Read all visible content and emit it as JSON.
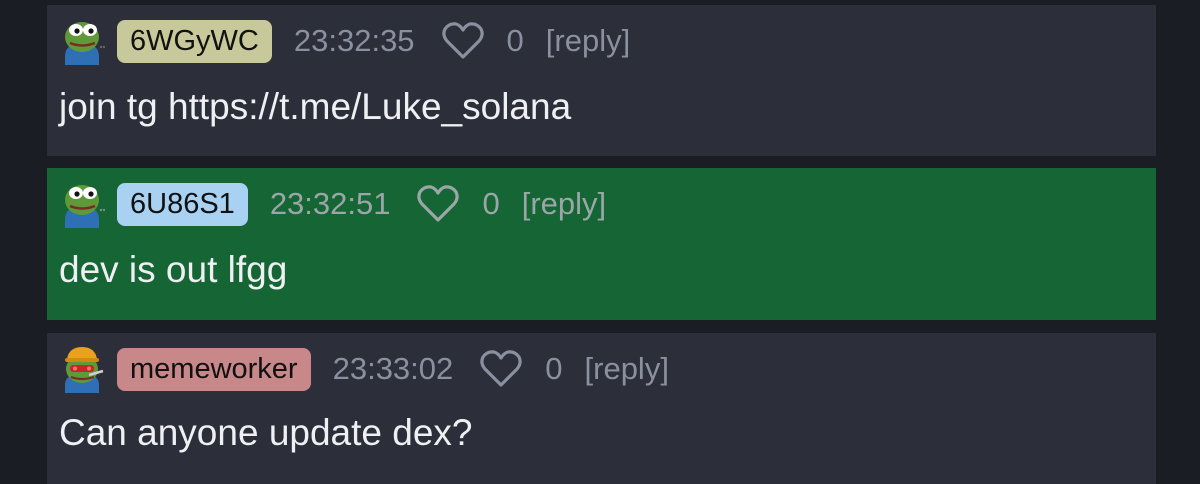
{
  "colors": {
    "background": "#1b1d25",
    "comment_bg": "#2c2e39",
    "highlight_bg": "#166534"
  },
  "comments": [
    {
      "avatar_icon": "pepe-avatar-icon",
      "username": "6WGyWC",
      "username_color": "#c8c99a",
      "time": "23:32:35",
      "likes": "0",
      "reply_label": "[reply]",
      "text": "join tg https://t.me/Luke_solana"
    },
    {
      "avatar_icon": "pepe-avatar-icon",
      "username": "6U86S1",
      "username_color": "#a8d1f2",
      "time": "23:32:51",
      "likes": "0",
      "reply_label": "[reply]",
      "text": "dev is out lfgg"
    },
    {
      "avatar_icon": "pepe-worker-avatar-icon",
      "username": "memeworker",
      "username_color": "#c8888a",
      "time": "23:33:02",
      "likes": "0",
      "reply_label": "[reply]",
      "text": "Can anyone update dex?"
    }
  ]
}
